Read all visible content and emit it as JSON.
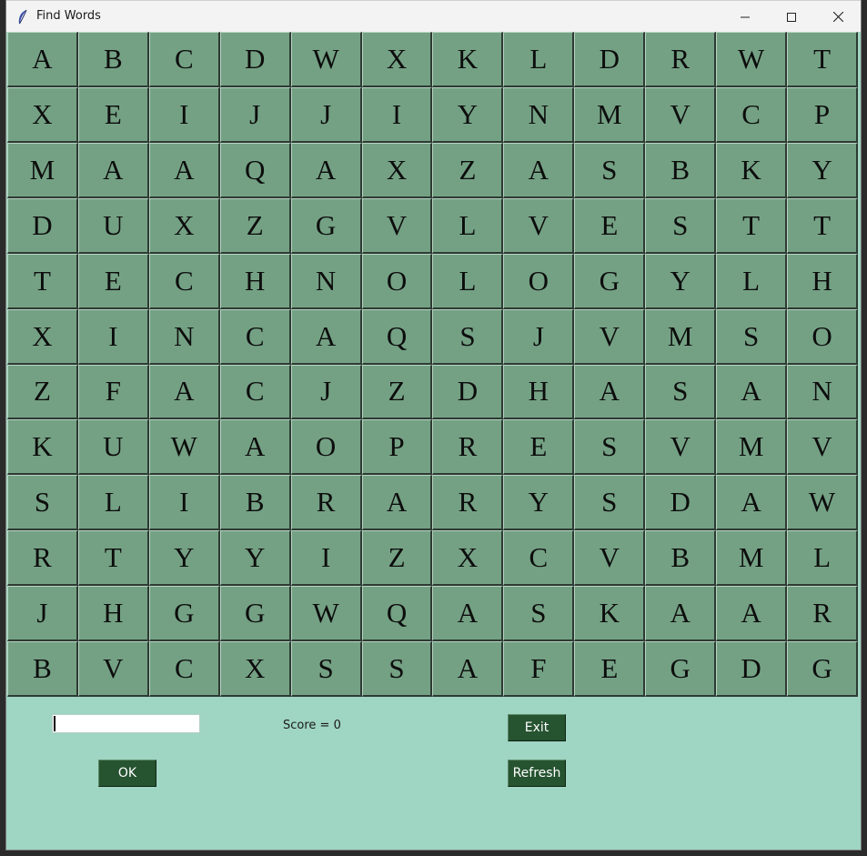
{
  "window": {
    "title": "Find Words"
  },
  "grid": [
    [
      "A",
      "B",
      "C",
      "D",
      "W",
      "X",
      "K",
      "L",
      "D",
      "R",
      "W",
      "T"
    ],
    [
      "X",
      "E",
      "I",
      "J",
      "J",
      "I",
      "Y",
      "N",
      "M",
      "V",
      "C",
      "P"
    ],
    [
      "M",
      "A",
      "A",
      "Q",
      "A",
      "X",
      "Z",
      "A",
      "S",
      "B",
      "K",
      "Y"
    ],
    [
      "D",
      "U",
      "X",
      "Z",
      "G",
      "V",
      "L",
      "V",
      "E",
      "S",
      "T",
      "T"
    ],
    [
      "T",
      "E",
      "C",
      "H",
      "N",
      "O",
      "L",
      "O",
      "G",
      "Y",
      "L",
      "H"
    ],
    [
      "X",
      "I",
      "N",
      "C",
      "A",
      "Q",
      "S",
      "J",
      "V",
      "M",
      "S",
      "O"
    ],
    [
      "Z",
      "F",
      "A",
      "C",
      "J",
      "Z",
      "D",
      "H",
      "A",
      "S",
      "A",
      "N"
    ],
    [
      "K",
      "U",
      "W",
      "A",
      "O",
      "P",
      "R",
      "E",
      "S",
      "V",
      "M",
      "V"
    ],
    [
      "S",
      "L",
      "I",
      "B",
      "R",
      "A",
      "R",
      "Y",
      "S",
      "D",
      "A",
      "W"
    ],
    [
      "R",
      "T",
      "Y",
      "Y",
      "I",
      "Z",
      "X",
      "C",
      "V",
      "B",
      "M",
      "L"
    ],
    [
      "J",
      "H",
      "G",
      "G",
      "W",
      "Q",
      "A",
      "S",
      "K",
      "A",
      "A",
      "R"
    ],
    [
      "B",
      "V",
      "C",
      "X",
      "S",
      "S",
      "A",
      "F",
      "E",
      "G",
      "D",
      "G"
    ]
  ],
  "controls": {
    "word_input_value": "",
    "score_text": "Score = 0",
    "ok_label": "OK",
    "exit_label": "Exit",
    "refresh_label": "Refresh"
  },
  "colors": {
    "cell_bg": "#74a184",
    "panel_bg": "#9fd5c3",
    "button_bg": "#265330"
  },
  "icons": {
    "app": "feather-icon",
    "minimize": "minimize-icon",
    "maximize": "maximize-icon",
    "close": "close-icon"
  }
}
